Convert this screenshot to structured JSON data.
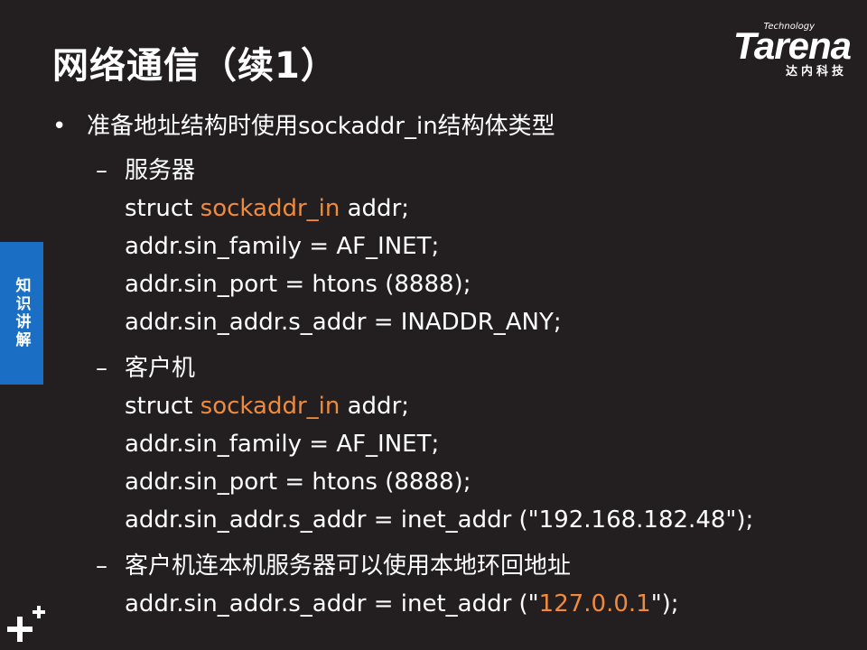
{
  "title": "网络通信（续1）",
  "logo": {
    "small": "Technology",
    "brand": "Tarena",
    "tagline": "达内科技"
  },
  "side_tab": "知识讲解",
  "bullet": "准备地址结构时使用sockaddr_in结构体类型",
  "server": {
    "heading": "服务器",
    "line1_pre": "struct ",
    "line1_hl": "sockaddr_in",
    "line1_post": " addr;",
    "line2": "addr.sin_family = AF_INET;",
    "line3": "addr.sin_port = htons (8888);",
    "line4": "addr.sin_addr.s_addr = INADDR_ANY;"
  },
  "client": {
    "heading": "客户机",
    "line1_pre": "struct ",
    "line1_hl": "sockaddr_in",
    "line1_post": " addr;",
    "line2": "addr.sin_family = AF_INET;",
    "line3": "addr.sin_port = htons (8888);",
    "line4": "addr.sin_addr.s_addr = inet_addr (\"192.168.182.48\");"
  },
  "loopback": {
    "heading": "客户机连本机服务器可以使用本地环回地址",
    "line_pre": "addr.sin_addr.s_addr = inet_addr (\"",
    "line_hl": "127.0.0.1",
    "line_post": "\");"
  },
  "colors": {
    "background": "#231f20",
    "highlight": "#f08a3c",
    "tab": "#1a6fc4"
  }
}
